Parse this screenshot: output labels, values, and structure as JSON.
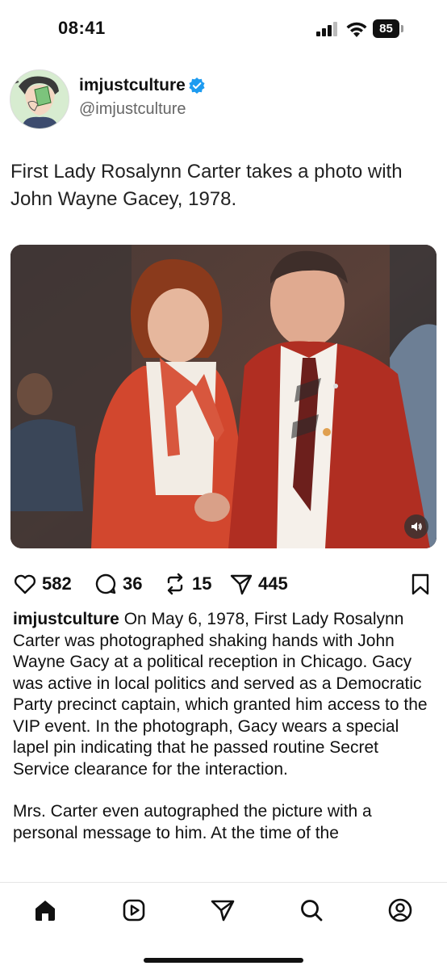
{
  "status_bar": {
    "time": "08:41",
    "battery": "85"
  },
  "post": {
    "username": "imjustculture",
    "handle": "@imjustculture",
    "text": "First Lady Rosalynn Carter takes a photo with John Wayne Gacey, 1978.",
    "likes": "582",
    "comments": "36",
    "reposts": "15",
    "shares": "445"
  },
  "caption": {
    "username": "imjustculture",
    "paragraph1": "On May 6, 1978, First Lady Rosalynn Carter was photographed shaking hands with John Wayne Gacy at a political reception in Chicago. Gacy was active in local politics and served as a Democratic Party precinct captain, which granted him access to the VIP event. In the photograph, Gacy wears a special lapel pin indicating that he passed routine Secret Service clearance for the interaction.",
    "paragraph2": "Mrs. Carter even autographed the picture with a personal message to him. At the time of the"
  },
  "colors": {
    "accent_blue": "#1d9bf0",
    "text": "#111111",
    "secondary": "#666666"
  },
  "icons": [
    "signal-icon",
    "wifi-icon",
    "battery-icon",
    "verified-badge-icon",
    "heart-icon",
    "comment-icon",
    "repost-icon",
    "share-icon",
    "bookmark-icon",
    "sound-icon",
    "home-icon",
    "reels-icon",
    "send-icon",
    "search-icon",
    "profile-icon"
  ]
}
